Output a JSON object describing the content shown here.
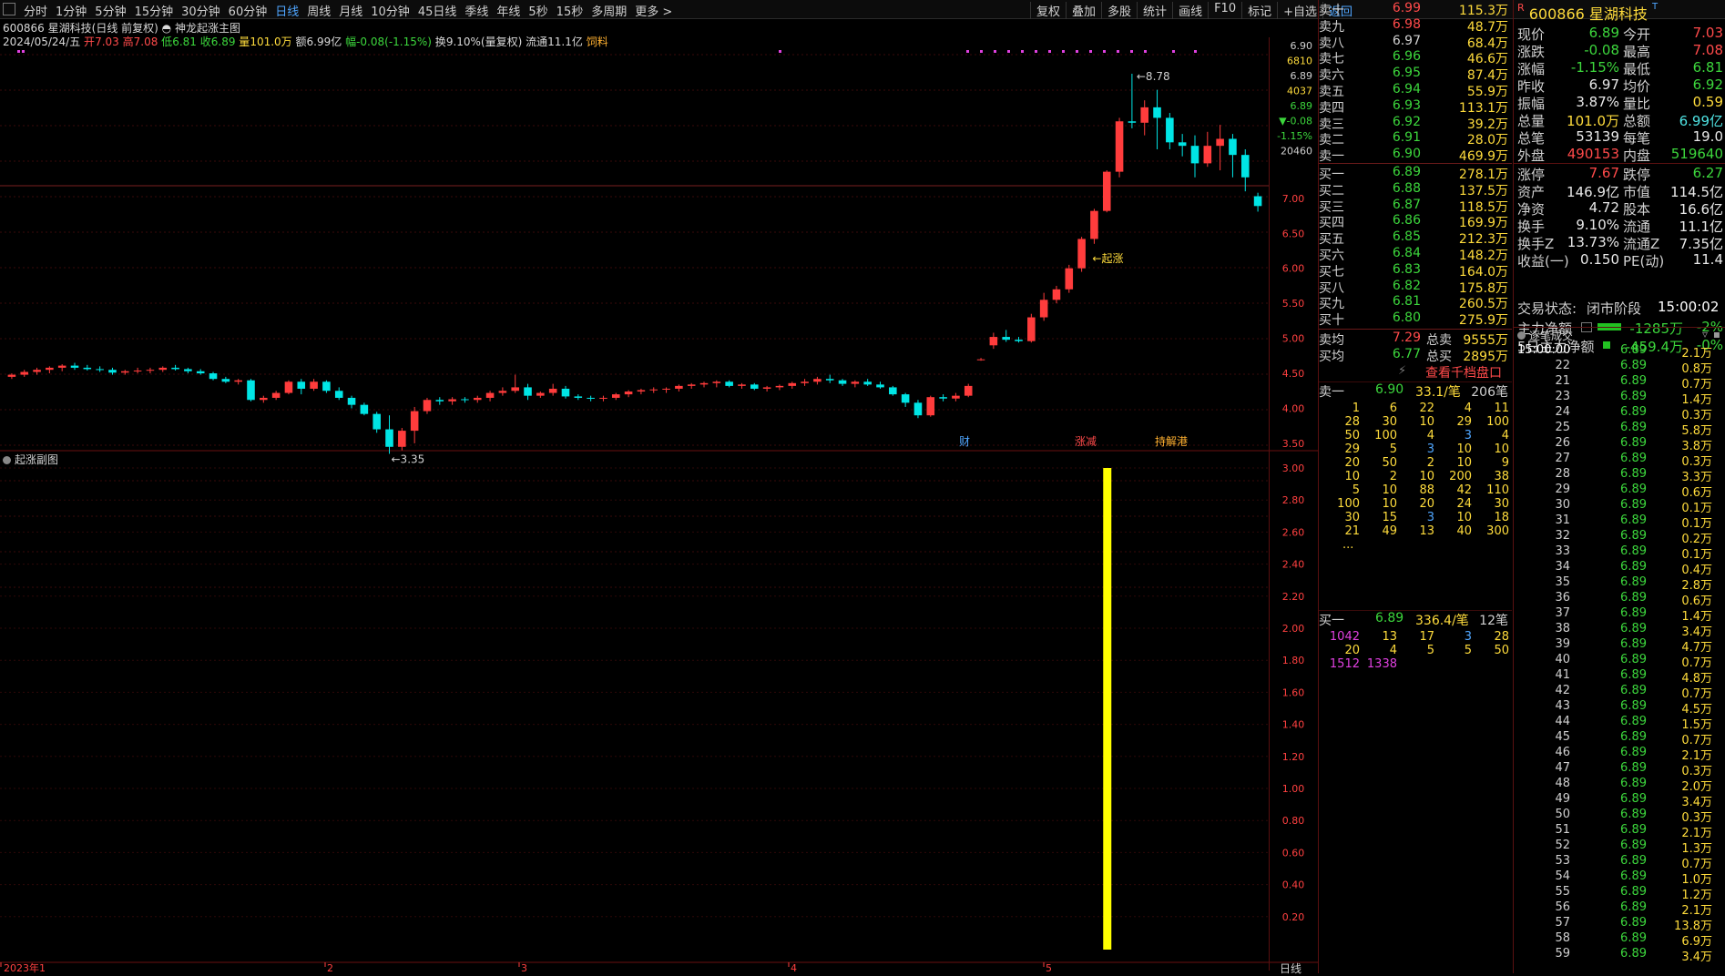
{
  "topbar": {
    "periods": [
      "分时",
      "1分钟",
      "5分钟",
      "15分钟",
      "30分钟",
      "60分钟",
      "日线",
      "周线",
      "月线",
      "10分钟",
      "45日线",
      "季线",
      "年线",
      "5秒",
      "15秒",
      "多周期",
      "更多 >"
    ],
    "active_period": "日线",
    "right_tools": [
      "复权",
      "叠加",
      "多股",
      "统计",
      "画线",
      "F10",
      "标记",
      "+自选",
      "返回"
    ]
  },
  "header": {
    "code": "600866",
    "name": "星湖科技",
    "adjust": "(日线 前复权)",
    "formula": "神龙起涨主图",
    "date": "2024/05/24/五",
    "open_label": "开",
    "open": "7.03",
    "high_label": "高",
    "high": "7.08",
    "low_label": "低",
    "low": "6.81",
    "close_label": "收",
    "close": "6.89",
    "vol_label": "量",
    "vol": "101.0万",
    "amt_label": "额",
    "amt": "6.99亿",
    "chg_label": "幅",
    "chg": "-0.08(-1.15%)",
    "turn_label": "换",
    "turn": "9.10%(量复权)",
    "float_label": "流通",
    "float": "11.1亿",
    "concept": "饲料"
  },
  "main_axis": {
    "ticks": [
      "7.00",
      "6.50",
      "6.00",
      "5.50",
      "5.00",
      "4.50",
      "4.00",
      "3.50"
    ],
    "readout": [
      "6.90",
      "6810",
      "6.89",
      "4037",
      "6.89",
      "▼-0.08",
      "-1.15%",
      "20460"
    ],
    "annot_high": "8.78",
    "annot_low": "3.35",
    "annot_start": "←起涨",
    "tags": [
      "财",
      "涨减",
      "持解港"
    ]
  },
  "sub_chart": {
    "title": "起涨副图",
    "ticks": [
      "3.00",
      "2.80",
      "2.60",
      "2.40",
      "2.20",
      "2.00",
      "1.80",
      "1.60",
      "1.40",
      "1.20",
      "1.00",
      "0.80",
      "0.60",
      "0.40",
      "0.20"
    ],
    "signal_value": 3.0
  },
  "x_axis": {
    "labels": [
      "2023年1",
      "2",
      "3",
      "4",
      "5"
    ]
  },
  "period_label": "日线",
  "chart_data": {
    "type": "candlestick",
    "y_range": [
      3.2,
      9.3
    ],
    "candles": [
      [
        4.45,
        4.5,
        4.42,
        4.48
      ],
      [
        4.48,
        4.55,
        4.45,
        4.52
      ],
      [
        4.52,
        4.58,
        4.48,
        4.55
      ],
      [
        4.55,
        4.6,
        4.5,
        4.58
      ],
      [
        4.58,
        4.63,
        4.53,
        4.61
      ],
      [
        4.61,
        4.65,
        4.55,
        4.58
      ],
      [
        4.58,
        4.62,
        4.54,
        4.56
      ],
      [
        4.56,
        4.6,
        4.52,
        4.55
      ],
      [
        4.55,
        4.58,
        4.48,
        4.51
      ],
      [
        4.51,
        4.55,
        4.48,
        4.53
      ],
      [
        4.53,
        4.58,
        4.5,
        4.54
      ],
      [
        4.54,
        4.58,
        4.5,
        4.55
      ],
      [
        4.55,
        4.6,
        4.52,
        4.58
      ],
      [
        4.58,
        4.62,
        4.54,
        4.56
      ],
      [
        4.56,
        4.58,
        4.5,
        4.53
      ],
      [
        4.53,
        4.56,
        4.48,
        4.5
      ],
      [
        4.5,
        4.52,
        4.4,
        4.42
      ],
      [
        4.42,
        4.45,
        4.36,
        4.38
      ],
      [
        4.38,
        4.42,
        4.34,
        4.4
      ],
      [
        4.4,
        4.42,
        4.1,
        4.12
      ],
      [
        4.12,
        4.18,
        4.08,
        4.15
      ],
      [
        4.15,
        4.25,
        4.12,
        4.22
      ],
      [
        4.22,
        4.4,
        4.2,
        4.38
      ],
      [
        4.38,
        4.42,
        4.2,
        4.28
      ],
      [
        4.28,
        4.42,
        4.25,
        4.38
      ],
      [
        4.38,
        4.4,
        4.22,
        4.25
      ],
      [
        4.25,
        4.3,
        4.12,
        4.15
      ],
      [
        4.15,
        4.18,
        4.0,
        4.05
      ],
      [
        4.05,
        4.08,
        3.9,
        3.92
      ],
      [
        3.92,
        3.95,
        3.65,
        3.7
      ],
      [
        3.7,
        3.9,
        3.35,
        3.45
      ],
      [
        3.45,
        3.72,
        3.4,
        3.68
      ],
      [
        3.68,
        4.02,
        3.5,
        3.96
      ],
      [
        3.96,
        4.15,
        3.92,
        4.12
      ],
      [
        4.12,
        4.16,
        4.05,
        4.1
      ],
      [
        4.1,
        4.16,
        4.05,
        4.13
      ],
      [
        4.13,
        4.16,
        4.08,
        4.12
      ],
      [
        4.12,
        4.18,
        4.08,
        4.15
      ],
      [
        4.15,
        4.25,
        4.1,
        4.22
      ],
      [
        4.22,
        4.3,
        4.18,
        4.25
      ],
      [
        4.25,
        4.48,
        4.22,
        4.3
      ],
      [
        4.3,
        4.35,
        4.12,
        4.18
      ],
      [
        4.18,
        4.24,
        4.15,
        4.22
      ],
      [
        4.22,
        4.35,
        4.18,
        4.28
      ],
      [
        4.28,
        4.32,
        4.14,
        4.17
      ],
      [
        4.17,
        4.2,
        4.12,
        4.15
      ],
      [
        4.15,
        4.18,
        4.1,
        4.14
      ],
      [
        4.14,
        4.18,
        4.1,
        4.15
      ],
      [
        4.15,
        4.22,
        4.12,
        4.2
      ],
      [
        4.2,
        4.26,
        4.16,
        4.24
      ],
      [
        4.24,
        4.28,
        4.2,
        4.26
      ],
      [
        4.26,
        4.3,
        4.22,
        4.27
      ],
      [
        4.27,
        4.3,
        4.22,
        4.28
      ],
      [
        4.28,
        4.34,
        4.24,
        4.32
      ],
      [
        4.32,
        4.36,
        4.28,
        4.34
      ],
      [
        4.34,
        4.38,
        4.3,
        4.36
      ],
      [
        4.36,
        4.4,
        4.3,
        4.38
      ],
      [
        4.38,
        4.4,
        4.3,
        4.32
      ],
      [
        4.32,
        4.36,
        4.28,
        4.34
      ],
      [
        4.34,
        4.36,
        4.26,
        4.28
      ],
      [
        4.28,
        4.32,
        4.24,
        4.3
      ],
      [
        4.3,
        4.34,
        4.26,
        4.32
      ],
      [
        4.32,
        4.38,
        4.28,
        4.36
      ],
      [
        4.36,
        4.42,
        4.32,
        4.38
      ],
      [
        4.38,
        4.45,
        4.34,
        4.42
      ],
      [
        4.42,
        4.48,
        4.36,
        4.4
      ],
      [
        4.4,
        4.42,
        4.32,
        4.35
      ],
      [
        4.35,
        4.4,
        4.3,
        4.38
      ],
      [
        4.38,
        4.42,
        4.32,
        4.34
      ],
      [
        4.34,
        4.38,
        4.28,
        4.3
      ],
      [
        4.3,
        4.32,
        4.18,
        4.2
      ],
      [
        4.2,
        4.22,
        4.02,
        4.08
      ],
      [
        4.08,
        4.12,
        3.86,
        3.9
      ],
      [
        3.9,
        4.18,
        3.88,
        4.16
      ],
      [
        4.16,
        4.2,
        4.1,
        4.14
      ],
      [
        4.14,
        4.22,
        4.1,
        4.18
      ],
      [
        4.18,
        4.35,
        4.16,
        4.32
      ],
      [
        4.7,
        4.72,
        4.68,
        4.7
      ],
      [
        4.9,
        5.08,
        4.85,
        5.02
      ],
      [
        5.02,
        5.12,
        4.95,
        4.98
      ],
      [
        4.98,
        5.02,
        4.94,
        4.96
      ],
      [
        4.96,
        5.35,
        4.94,
        5.3
      ],
      [
        5.3,
        5.65,
        5.25,
        5.55
      ],
      [
        5.55,
        5.75,
        5.5,
        5.7
      ],
      [
        5.7,
        6.05,
        5.65,
        6.0
      ],
      [
        6.0,
        6.45,
        5.95,
        6.42
      ],
      [
        6.42,
        6.85,
        6.35,
        6.82
      ],
      [
        6.82,
        7.4,
        6.8,
        7.38
      ],
      [
        7.38,
        8.15,
        7.3,
        8.1
      ],
      [
        8.1,
        8.78,
        8.0,
        8.08
      ],
      [
        8.08,
        8.4,
        7.9,
        8.3
      ],
      [
        8.3,
        8.55,
        7.7,
        8.15
      ],
      [
        8.15,
        8.22,
        7.7,
        7.8
      ],
      [
        7.8,
        7.92,
        7.6,
        7.75
      ],
      [
        7.75,
        7.9,
        7.3,
        7.5
      ],
      [
        7.5,
        7.95,
        7.45,
        7.75
      ],
      [
        7.75,
        8.05,
        7.4,
        7.85
      ],
      [
        7.85,
        7.92,
        7.3,
        7.62
      ],
      [
        7.62,
        7.7,
        7.1,
        7.3
      ],
      [
        7.03,
        7.08,
        6.81,
        6.89
      ]
    ]
  },
  "book": {
    "asks": [
      {
        "label": "卖十",
        "price": "6.99",
        "vol": "115.3万"
      },
      {
        "label": "卖九",
        "price": "6.98",
        "vol": "48.7万"
      },
      {
        "label": "卖八",
        "price": "6.97",
        "vol": "68.4万"
      },
      {
        "label": "卖七",
        "price": "6.96",
        "vol": "46.6万"
      },
      {
        "label": "卖六",
        "price": "6.95",
        "vol": "87.4万"
      },
      {
        "label": "卖五",
        "price": "6.94",
        "vol": "55.9万"
      },
      {
        "label": "卖四",
        "price": "6.93",
        "vol": "113.1万"
      },
      {
        "label": "卖三",
        "price": "6.92",
        "vol": "39.2万"
      },
      {
        "label": "卖二",
        "price": "6.91",
        "vol": "28.0万"
      },
      {
        "label": "卖一",
        "price": "6.90",
        "vol": "469.9万"
      }
    ],
    "bids": [
      {
        "label": "买一",
        "price": "6.89",
        "vol": "278.1万"
      },
      {
        "label": "买二",
        "price": "6.88",
        "vol": "137.5万"
      },
      {
        "label": "买三",
        "price": "6.87",
        "vol": "118.5万"
      },
      {
        "label": "买四",
        "price": "6.86",
        "vol": "169.9万"
      },
      {
        "label": "买五",
        "price": "6.85",
        "vol": "212.3万"
      },
      {
        "label": "买六",
        "price": "6.84",
        "vol": "148.2万"
      },
      {
        "label": "买七",
        "price": "6.83",
        "vol": "164.0万"
      },
      {
        "label": "买八",
        "price": "6.82",
        "vol": "175.8万"
      },
      {
        "label": "买九",
        "price": "6.81",
        "vol": "260.5万"
      },
      {
        "label": "买十",
        "price": "6.80",
        "vol": "275.9万"
      }
    ],
    "summary": [
      {
        "label": "卖均",
        "price": "7.29",
        "label2": "总卖",
        "vol": "9555万"
      },
      {
        "label": "买均",
        "price": "6.77",
        "label2": "总买",
        "vol": "2895万"
      }
    ],
    "qian_btn": "查看千档盘口",
    "ask_queue": {
      "label": "卖一",
      "price": "6.90",
      "avg": "33.1/笔",
      "count": "206笔",
      "rows": [
        [
          "1",
          "6",
          "22",
          "4",
          "11"
        ],
        [
          "28",
          "30",
          "10",
          "29",
          "100"
        ],
        [
          "50",
          "100",
          "4",
          "3",
          "4"
        ],
        [
          "29",
          "5",
          "3",
          "10",
          "10"
        ],
        [
          "20",
          "50",
          "2",
          "10",
          "9"
        ],
        [
          "10",
          "2",
          "10",
          "200",
          "38"
        ],
        [
          "5",
          "10",
          "88",
          "42",
          "110"
        ],
        [
          "100",
          "10",
          "20",
          "24",
          "30"
        ],
        [
          "30",
          "15",
          "3",
          "10",
          "18"
        ],
        [
          "21",
          "49",
          "13",
          "40",
          "300"
        ]
      ],
      "more": "..."
    },
    "bid_queue": {
      "label": "买一",
      "price": "6.89",
      "avg": "336.4/笔",
      "count": "12笔",
      "rows": [
        [
          "1042",
          "13",
          "17",
          "3",
          "28"
        ],
        [
          "20",
          "4",
          "5",
          "5",
          "50"
        ],
        [
          "1512",
          "1338"
        ]
      ]
    }
  },
  "quote": {
    "badge": "R",
    "code": "600866",
    "name": "星湖科技",
    "rows": [
      {
        "l1": "现价",
        "v1": "6.89",
        "c1": "g",
        "l2": "今开",
        "v2": "7.03",
        "c2": "r"
      },
      {
        "l1": "涨跌",
        "v1": "-0.08",
        "c1": "g",
        "l2": "最高",
        "v2": "7.08",
        "c2": "r"
      },
      {
        "l1": "涨幅",
        "v1": "-1.15%",
        "c1": "g",
        "l2": "最低",
        "v2": "6.81",
        "c2": "g"
      },
      {
        "l1": "昨收",
        "v1": "6.97",
        "c1": "w",
        "l2": "均价",
        "v2": "6.92",
        "c2": "g"
      },
      {
        "l1": "振幅",
        "v1": "3.87%",
        "c1": "w",
        "l2": "量比",
        "v2": "0.59",
        "c2": "y"
      },
      {
        "l1": "总量",
        "v1": "101.0万",
        "c1": "y",
        "l2": "总额",
        "v2": "6.99亿",
        "c2": "c"
      },
      {
        "l1": "总笔",
        "v1": "53139",
        "c1": "w",
        "l2": "每笔",
        "v2": "19.0",
        "c2": "w"
      },
      {
        "l1": "外盘",
        "v1": "490153",
        "c1": "r",
        "l2": "内盘",
        "v2": "519640",
        "c2": "g"
      },
      {
        "l1": "涨停",
        "v1": "7.67",
        "c1": "r",
        "l2": "跌停",
        "v2": "6.27",
        "c2": "g"
      },
      {
        "l1": "资产",
        "v1": "146.9亿",
        "c1": "w",
        "l2": "市值",
        "v2": "114.5亿",
        "c2": "w"
      },
      {
        "l1": "净资",
        "v1": "4.72",
        "c1": "w",
        "l2": "股本",
        "v2": "16.6亿",
        "c2": "w"
      },
      {
        "l1": "换手",
        "v1": "9.10%",
        "c1": "w",
        "l2": "流通",
        "v2": "11.1亿",
        "c2": "w"
      },
      {
        "l1": "换手Z",
        "v1": "13.73%",
        "c1": "w",
        "l2": "流通Z",
        "v2": "7.35亿",
        "c2": "w"
      },
      {
        "l1": "收益(一)",
        "v1": "0.150",
        "c1": "w",
        "l2": "PE(动)",
        "v2": "11.4",
        "c2": "w"
      }
    ],
    "status_label": "交易状态:",
    "status": "闭市阶段",
    "status_time": "15:00:02",
    "flow1_label": "主力净额",
    "flow1_val": "-1285万",
    "flow1_pct": "-2%",
    "flow2_label": "5日主力净额",
    "flow2_val": "-459.4万",
    "flow2_pct": "-0%",
    "tick_title": "逐笔成交",
    "ticks": [
      [
        "15:00:00",
        "6.89",
        "2.1万"
      ],
      [
        "22",
        "6.89",
        "0.8万"
      ],
      [
        "21",
        "6.89",
        "0.7万"
      ],
      [
        "23",
        "6.89",
        "1.4万"
      ],
      [
        "24",
        "6.89",
        "0.3万"
      ],
      [
        "25",
        "6.89",
        "5.8万"
      ],
      [
        "26",
        "6.89",
        "3.8万"
      ],
      [
        "27",
        "6.89",
        "0.3万"
      ],
      [
        "28",
        "6.89",
        "3.3万"
      ],
      [
        "29",
        "6.89",
        "0.6万"
      ],
      [
        "30",
        "6.89",
        "0.1万"
      ],
      [
        "31",
        "6.89",
        "0.1万"
      ],
      [
        "32",
        "6.89",
        "0.2万"
      ],
      [
        "33",
        "6.89",
        "0.1万"
      ],
      [
        "34",
        "6.89",
        "0.4万"
      ],
      [
        "35",
        "6.89",
        "2.8万"
      ],
      [
        "36",
        "6.89",
        "0.6万"
      ],
      [
        "37",
        "6.89",
        "1.4万"
      ],
      [
        "38",
        "6.89",
        "3.4万"
      ],
      [
        "39",
        "6.89",
        "4.7万"
      ],
      [
        "40",
        "6.89",
        "0.7万"
      ],
      [
        "41",
        "6.89",
        "4.8万"
      ],
      [
        "42",
        "6.89",
        "0.7万"
      ],
      [
        "43",
        "6.89",
        "4.5万"
      ],
      [
        "44",
        "6.89",
        "1.5万"
      ],
      [
        "45",
        "6.89",
        "0.7万"
      ],
      [
        "46",
        "6.89",
        "2.1万"
      ],
      [
        "47",
        "6.89",
        "0.3万"
      ],
      [
        "48",
        "6.89",
        "2.0万"
      ],
      [
        "49",
        "6.89",
        "3.4万"
      ],
      [
        "50",
        "6.89",
        "0.3万"
      ],
      [
        "51",
        "6.89",
        "2.1万"
      ],
      [
        "52",
        "6.89",
        "1.3万"
      ],
      [
        "53",
        "6.89",
        "0.7万"
      ],
      [
        "54",
        "6.89",
        "1.0万"
      ],
      [
        "55",
        "6.89",
        "1.2万"
      ],
      [
        "56",
        "6.89",
        "2.1万"
      ],
      [
        "57",
        "6.89",
        "13.8万"
      ],
      [
        "58",
        "6.89",
        "6.9万"
      ],
      [
        "59",
        "6.89",
        "3.4万"
      ]
    ]
  }
}
